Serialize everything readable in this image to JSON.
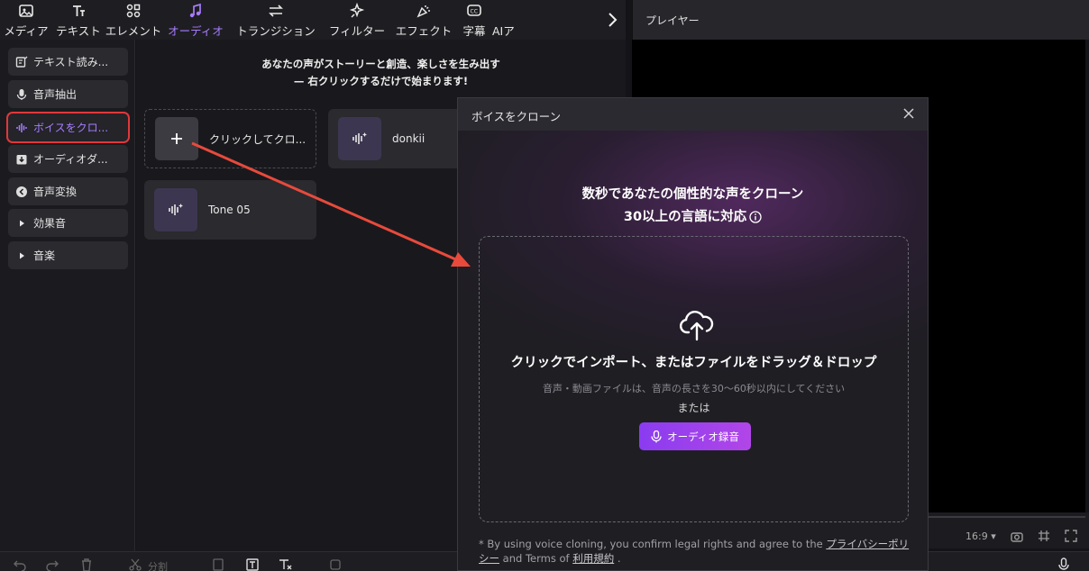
{
  "toolbar": {
    "tabs": [
      {
        "label": "メディア",
        "icon": "media-icon"
      },
      {
        "label": "テキスト",
        "icon": "text-icon"
      },
      {
        "label": "エレメント",
        "icon": "elements-icon"
      },
      {
        "label": "オーディオ",
        "icon": "audio-icon"
      },
      {
        "label": "トランジション",
        "icon": "transition-icon"
      },
      {
        "label": "フィルター",
        "icon": "filter-icon"
      },
      {
        "label": "エフェクト",
        "icon": "effect-icon"
      },
      {
        "label": "字幕",
        "icon": "subtitle-icon"
      },
      {
        "label": "AIア",
        "icon": "ai-icon"
      }
    ],
    "active_tab": "オーディオ",
    "accent_color": "#a77cff"
  },
  "player": {
    "title": "プレイヤー",
    "ratio": "16:9"
  },
  "sidebar": {
    "items": [
      {
        "label": "テキスト読み...",
        "icon": "text-to-speech-icon"
      },
      {
        "label": "音声抽出",
        "icon": "microphone-icon"
      },
      {
        "label": "ボイスをクロ...",
        "icon": "voice-wave-icon"
      },
      {
        "label": "オーディオダ...",
        "icon": "audio-download-icon"
      },
      {
        "label": "音声変換",
        "icon": "voice-change-icon"
      },
      {
        "label": "効果音",
        "icon": "triangle-right-icon"
      },
      {
        "label": "音楽",
        "icon": "triangle-right-icon"
      }
    ],
    "highlight_color": "#e0383a"
  },
  "main": {
    "banner_line1": "あなたの声がストーリーと創造、楽しさを生み出す",
    "banner_line2": "— 右クリックするだけで始まります!",
    "clone_card_label": "クリックしてクロ...",
    "voice_cards": [
      "donkii",
      "Tone 05"
    ]
  },
  "bottombar": {
    "split_label": "分割"
  },
  "dialog": {
    "title": "ボイスをクローン",
    "headline1": "数秒であなたの個性的な声をクローン",
    "headline2": "30以上の言語に対応",
    "drop_title": "クリックでインポート、またはファイルをドラッグ＆ドロップ",
    "drop_sub": "音声・動画ファイルは、音声の長さを30～60秒以内にしてください",
    "drop_or": "または",
    "record_button": "オーディオ録音",
    "footer_prefix": "* By using voice cloning, you confirm legal rights and agree to the",
    "privacy_link": "プライバシーポリシー",
    "footer_mid": "and Terms of",
    "terms_link": "利用規約",
    "footer_end": ".",
    "button_gradient": [
      "#8a3cf0",
      "#b146e8"
    ]
  }
}
